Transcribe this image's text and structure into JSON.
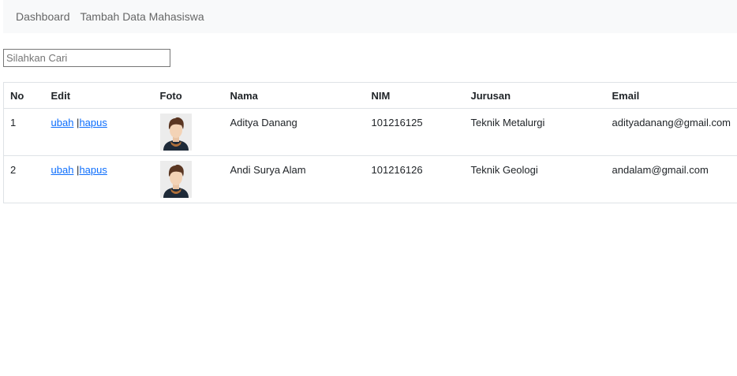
{
  "nav": {
    "items": [
      {
        "label": "Dashboard"
      },
      {
        "label": "Tambah Data Mahasiswa"
      }
    ]
  },
  "search": {
    "placeholder": "Silahkan Cari",
    "value": ""
  },
  "table": {
    "headers": [
      "No",
      "Edit",
      "Foto",
      "Nama",
      "NIM",
      "Jurusan",
      "Email"
    ],
    "rows": [
      {
        "no": "1",
        "edit_label": "ubah",
        "separator": "|",
        "delete_label": "hapus",
        "foto": "avatar-icon",
        "nama": "Aditya Danang",
        "nim": "101216125",
        "jurusan": "Teknik Metalurgi",
        "email": "adityadanang@gmail.com"
      },
      {
        "no": "2",
        "edit_label": "ubah",
        "separator": "|",
        "delete_label": "hapus",
        "foto": "avatar-icon",
        "nama": "Andi Surya Alam",
        "nim": "101216126",
        "jurusan": "Teknik Geologi",
        "email": "andalam@gmail.com"
      }
    ]
  },
  "colors": {
    "navbar_bg": "#f8f9fa",
    "link": "#0d6efd",
    "border": "#dee2e6"
  }
}
